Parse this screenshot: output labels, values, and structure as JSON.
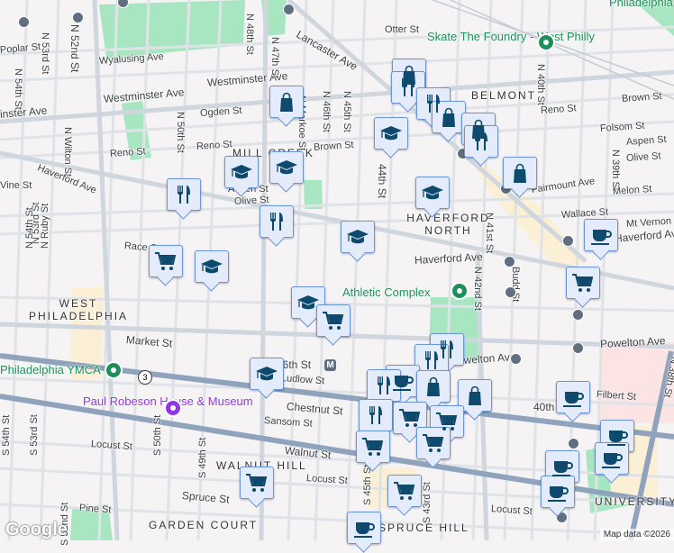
{
  "streets": [
    "Otter St",
    "Poplar St",
    "N 53rd St",
    "N 52nd St",
    "Wyalusing Ave",
    "Westminster Ave",
    "Westminster Ave",
    "inster Ave",
    "Ogden St",
    "N 54th St",
    "N Wilton St",
    "N 50th St",
    "Reno St",
    "Reno St",
    "Haverford Ave",
    "Vine St",
    "N 48th St",
    "N 47th St",
    "Lancaster Ave",
    "N Markoe St",
    "N 46th St",
    "N 45th St",
    "Brown St",
    "Aspen St",
    "Olive St",
    "44th St",
    "N 41st St",
    "N 40th St",
    "N 39th St",
    "Reno St",
    "Brown St",
    "Folsom St",
    "Aspen St",
    "Olive St",
    "Fairmount Ave",
    "Melon St",
    "Wallace St",
    "Mt Vernon",
    "Haverford Ave",
    "Haverford Ave",
    "Race St",
    "N 42nd St",
    "Budd St",
    "Market St",
    "Powelton Ave",
    "Powelton Ave",
    "Filbert St",
    "Chestnut St",
    "Sansom St",
    "Walnut St",
    "Locust St",
    "Locust St",
    "Locust St",
    "S 50th St",
    "S 49th St",
    "S 45th St",
    "S 43rd St",
    "S 52nd St",
    "S 53rd St",
    "S 54th St",
    "Spruce St",
    "Pine St",
    "N 53rd St",
    "N 54th St",
    "N Ruby St",
    "40th St",
    "46th St",
    "Ludlow St",
    "N 38th St"
  ],
  "neighborhoods": [
    "BELMONT",
    "MILL CREEK",
    "HAVERFORD NORTH",
    "WEST PHILADELPHIA",
    "WALNUT HILL",
    "GARDEN COURT",
    "SPRUCE HILL",
    "UNIVERSITY",
    "Philadelphia"
  ],
  "pois": {
    "skate": "Skate The Foundry - West Philly",
    "athletic": "Athletic Complex",
    "ymca": "Philadelphia YMCA",
    "museum": "Paul Robeson House & Museum"
  },
  "route_shield": "3",
  "metro_symbol": "M",
  "logo": "Google",
  "attribution": "Map data ©2026",
  "colors": {
    "marker_icon": "#0d4a6e",
    "marker_bg": "#e4ecfb",
    "park": "#a8e6c1",
    "arterial": "#8fa3bd"
  },
  "markers": [
    "shopping",
    "school",
    "school",
    "restaurant",
    "restaurant",
    "school",
    "school",
    "school",
    "grocery",
    "school",
    "school",
    "grocery",
    "school",
    "shopping",
    "restaurant",
    "restaurant",
    "shopping",
    "shopping",
    "restaurant",
    "shopping",
    "cafe",
    "grocery",
    "restaurant",
    "restaurant",
    "cafe",
    "restaurant",
    "shopping",
    "shopping",
    "restaurant",
    "grocery",
    "grocery",
    "grocery",
    "grocery",
    "cafe",
    "cafe",
    "cafe",
    "cafe",
    "cafe",
    "grocery",
    "grocery",
    "cafe"
  ]
}
